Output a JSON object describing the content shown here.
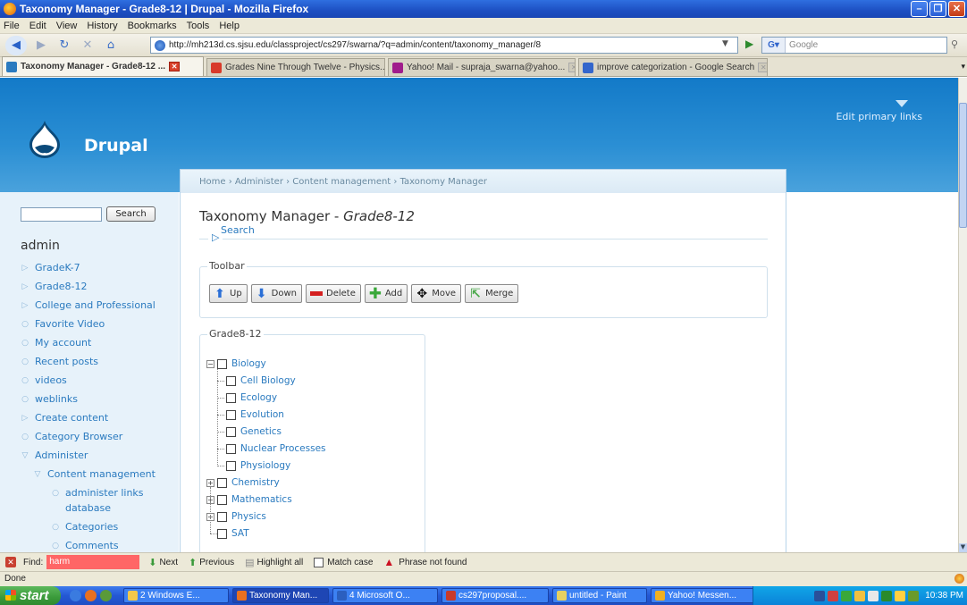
{
  "window": {
    "title": "Taxonomy Manager - Grade8-12 | Drupal - Mozilla Firefox",
    "controls": [
      "minimize",
      "restore",
      "close"
    ]
  },
  "menubar": [
    "File",
    "Edit",
    "View",
    "History",
    "Bookmarks",
    "Tools",
    "Help"
  ],
  "navigation": {
    "url": "http://mh213d.cs.sjsu.edu/classproject/cs297/swarna/?q=admin/content/taxonomy_manager/8",
    "search_engine": "Google",
    "search_placeholder": "Google"
  },
  "tabs": [
    {
      "label": "Taxonomy Manager - Grade8-12 ...",
      "active": true,
      "icon_color": "#2a7abf"
    },
    {
      "label": "Grades Nine Through Twelve - Physics...",
      "active": false,
      "icon_color": "#d83a2a"
    },
    {
      "label": "Yahoo! Mail - supraja_swarna@yahoo...",
      "active": false,
      "icon_color": "#a01c8c"
    },
    {
      "label": "improve categorization - Google Search",
      "active": false,
      "icon_color": "#3366cc"
    }
  ],
  "site": {
    "name": "Drupal",
    "primary_links_label": "Edit primary links"
  },
  "breadcrumb": "Home › Administer › Content management › Taxonomy Manager",
  "content": {
    "title_prefix": "Taxonomy Manager - ",
    "title_vocab": "Grade8-12",
    "search_label": "Search",
    "toolbar_legend": "Toolbar",
    "toolbar_buttons": [
      {
        "label": "Up",
        "icon": "arrow-up-icon"
      },
      {
        "label": "Down",
        "icon": "arrow-down-icon"
      },
      {
        "label": "Delete",
        "icon": "delete-icon"
      },
      {
        "label": "Add",
        "icon": "add-icon"
      },
      {
        "label": "Move",
        "icon": "move-icon"
      },
      {
        "label": "Merge",
        "icon": "merge-icon"
      }
    ],
    "tree_legend": "Grade8-12",
    "tree": [
      {
        "label": "Biology",
        "expanded": true,
        "children": [
          "Cell Biology",
          "Ecology",
          "Evolution",
          "Genetics",
          "Nuclear Processes",
          "Physiology"
        ]
      },
      {
        "label": "Chemistry",
        "expanded": false,
        "children": []
      },
      {
        "label": "Mathematics",
        "expanded": false,
        "children": []
      },
      {
        "label": "Physics",
        "expanded": false,
        "children": []
      },
      {
        "label": "SAT",
        "expanded": false,
        "children": []
      }
    ]
  },
  "sidebar": {
    "search_button": "Search",
    "user": "admin",
    "items": [
      {
        "label": "GradeK-7",
        "marker": "▷"
      },
      {
        "label": "Grade8-12",
        "marker": "▷"
      },
      {
        "label": "College and Professional",
        "marker": "▷"
      },
      {
        "label": "Favorite Video",
        "marker": "○"
      },
      {
        "label": "My account",
        "marker": "○"
      },
      {
        "label": "Recent posts",
        "marker": "○"
      },
      {
        "label": "videos",
        "marker": "○"
      },
      {
        "label": "weblinks",
        "marker": "○"
      },
      {
        "label": "Create content",
        "marker": "▷"
      },
      {
        "label": "Category Browser",
        "marker": "○"
      },
      {
        "label": "Administer",
        "marker": "▽"
      },
      {
        "label": "Content management",
        "marker": "▽"
      },
      {
        "label": "administer links",
        "marker": "○"
      },
      {
        "label": "database",
        "marker": ""
      },
      {
        "label": "Categories",
        "marker": "○"
      },
      {
        "label": "Comments",
        "marker": "○"
      }
    ]
  },
  "findbar": {
    "label": "Find:",
    "value": "harm",
    "next": "Next",
    "previous": "Previous",
    "highlight_all": "Highlight all",
    "match_case": "Match case",
    "status": "Phrase not found"
  },
  "statusbar": {
    "text": "Done"
  },
  "taskbar": {
    "start": "start",
    "tasks": [
      {
        "label": "2 Windows E...",
        "icon_color": "#f2c84a"
      },
      {
        "label": "Taxonomy Man...",
        "icon_color": "#e87020",
        "active": true
      },
      {
        "label": "4 Microsoft O...",
        "icon_color": "#2b5fbf"
      },
      {
        "label": "cs297proposal....",
        "icon_color": "#c83a2a"
      },
      {
        "label": "untitled - Paint",
        "icon_color": "#e6d060"
      },
      {
        "label": "Yahoo! Messen...",
        "icon_color": "#f0b020"
      }
    ],
    "clock": "10:38 PM"
  }
}
